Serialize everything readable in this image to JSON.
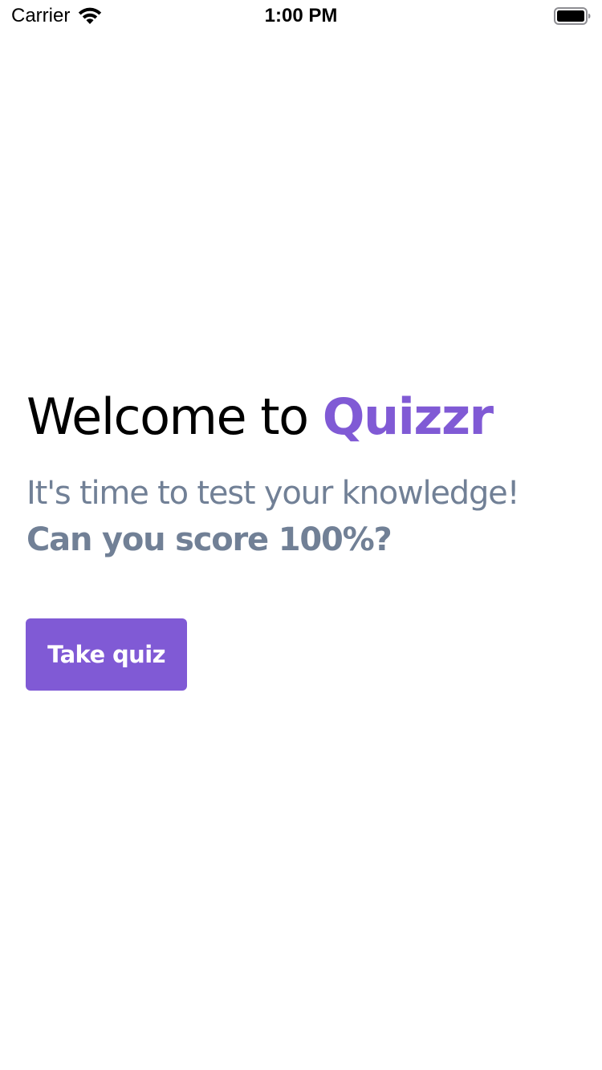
{
  "status_bar": {
    "carrier": "Carrier",
    "time": "1:00 PM",
    "wifi_icon": "wifi-icon",
    "battery_icon": "battery-icon",
    "battery_level": 1.0
  },
  "main": {
    "title_prefix": "Welcome to ",
    "brand_name": "Quizzr",
    "tagline": "It's time to test your knowledge!",
    "tagline_emphasis": "Can you score 100%?",
    "cta_label": "Take quiz"
  },
  "colors": {
    "brand": "#805AD5",
    "muted_text": "#718096",
    "background": "#FFFFFF",
    "title_text": "#000000"
  }
}
